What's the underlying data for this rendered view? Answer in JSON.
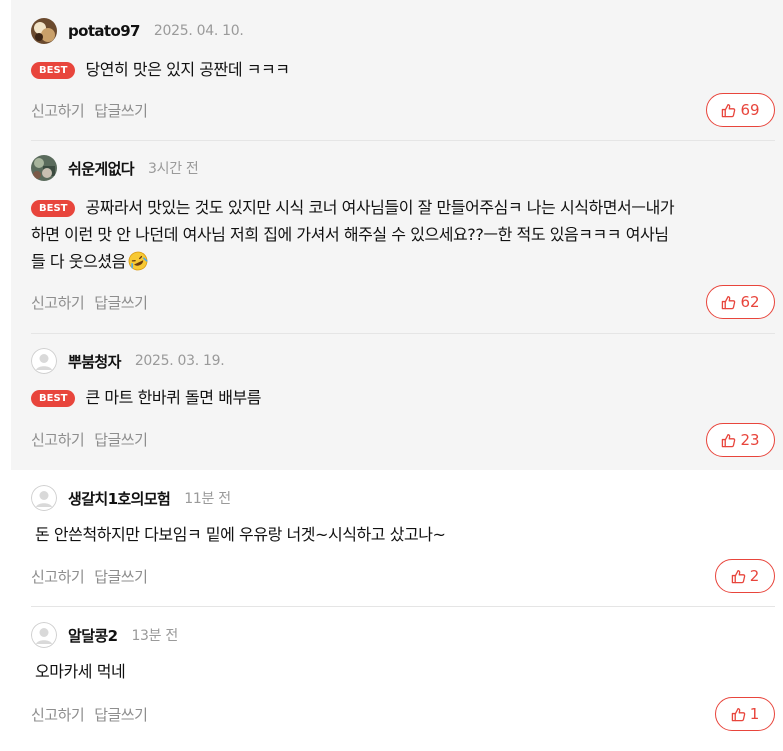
{
  "actions": {
    "report": "신고하기",
    "reply": "답글쓰기"
  },
  "best_badge": "BEST",
  "comments": [
    {
      "nickname": "potato97",
      "date": "2025. 04. 10.",
      "best": true,
      "text": "당연히 맛은 있지 공짠데 ㅋㅋㅋ",
      "likes": "69"
    },
    {
      "nickname": "쉬운게없다",
      "date": "3시간 전",
      "best": true,
      "text_lines": [
        "공짜라서 맛있는 것도 있지만 시식 코너 여사님들이 잘 만들어주심ㅋ 나는 시식하면서ㅡ내가",
        "하면 이런 맛 안 나던데 여사님 저희 집에 가셔서 해주실 수 있으세요??ㅡ한 적도 있음ㅋㅋㅋ 여사님",
        "들 다 웃으셨음"
      ],
      "emoji": "rolling-on-floor-laughing-emoji",
      "likes": "62"
    },
    {
      "nickname": "뿌붐청자",
      "date": "2025. 03. 19.",
      "best": true,
      "text": "큰 마트 한바퀴 돌면 배부름",
      "likes": "23"
    },
    {
      "nickname": "생갈치1호의모험",
      "date": "11분 전",
      "best": false,
      "text": "돈 안쓴척하지만 다보임ㅋ 밑에 우유랑 너겟~시식하고 샀고나~",
      "likes": "2"
    },
    {
      "nickname": "알달콩2",
      "date": "13분 전",
      "best": false,
      "text": "오마카세 먹네",
      "likes": "1"
    }
  ],
  "colors": {
    "accent": "#e8453c",
    "best_background": "#f5f5f5",
    "muted_text": "#8e8e8e"
  }
}
